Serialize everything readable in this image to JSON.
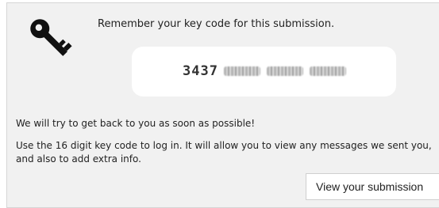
{
  "notice": {
    "icon": "key-icon",
    "reminder_text": "Remember your key code for this submission.",
    "key_code_visible": "3437"
  },
  "messages": {
    "reply": "We will try to get back to you as soon as possible!",
    "instructions": "Use the 16 digit key code to log in. It will allow you to view any messages we sent you, and also to add extra info."
  },
  "actions": {
    "view_submission_label": "View your submission"
  }
}
